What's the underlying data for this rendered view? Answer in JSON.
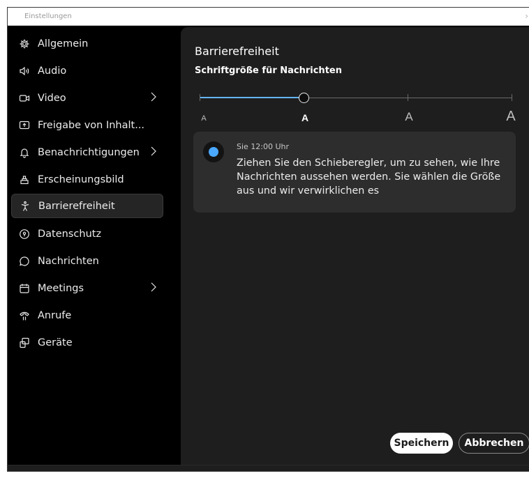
{
  "window": {
    "title": "Einstellungen"
  },
  "sidebar": {
    "items": [
      {
        "label": "Allgemein",
        "icon": "gear-icon",
        "has_submenu": false,
        "active": false
      },
      {
        "label": "Audio",
        "icon": "speaker-icon",
        "has_submenu": false,
        "active": false
      },
      {
        "label": "Video",
        "icon": "video-camera-icon",
        "has_submenu": true,
        "active": false
      },
      {
        "label": "Freigabe von Inhalt...",
        "icon": "share-screen-icon",
        "has_submenu": false,
        "active": false
      },
      {
        "label": "Benachrichtigungen",
        "icon": "bell-icon",
        "has_submenu": true,
        "active": false
      },
      {
        "label": "Erscheinungsbild",
        "icon": "appearance-icon",
        "has_submenu": false,
        "active": false
      },
      {
        "label": "Barrierefreiheit",
        "icon": "accessibility-icon",
        "has_submenu": false,
        "active": true
      },
      {
        "label": "Datenschutz",
        "icon": "privacy-icon",
        "has_submenu": false,
        "active": false
      },
      {
        "label": "Nachrichten",
        "icon": "chat-bubble-icon",
        "has_submenu": false,
        "active": false
      },
      {
        "label": "Meetings",
        "icon": "calendar-icon",
        "has_submenu": true,
        "active": false
      },
      {
        "label": "Anrufe",
        "icon": "phone-icon",
        "has_submenu": false,
        "active": false
      },
      {
        "label": "Geräte",
        "icon": "devices-icon",
        "has_submenu": false,
        "active": false
      }
    ]
  },
  "main": {
    "title": "Barrierefreiheit",
    "section_title": "Schriftgröße für Nachrichten",
    "font_size_slider": {
      "labels": [
        "A",
        "A",
        "A",
        "A"
      ],
      "selected_index": 1,
      "steps": 4,
      "fill_color": "#64b5f6"
    },
    "preview": {
      "sender": "Sie",
      "time": "12:00 Uhr",
      "text": "Ziehen Sie den Schieberegler, um zu sehen, wie Ihre Nachrichten aussehen werden. Sie wählen die Größe aus und wir verwirklichen es",
      "avatar_color": "#4aa8ff"
    }
  },
  "footer": {
    "save_label": "Speichern",
    "cancel_label": "Abbrechen"
  },
  "colors": {
    "background": "#000000",
    "panel": "#1e1e1e",
    "card": "#2d2d2d",
    "accent": "#64b5f6"
  }
}
